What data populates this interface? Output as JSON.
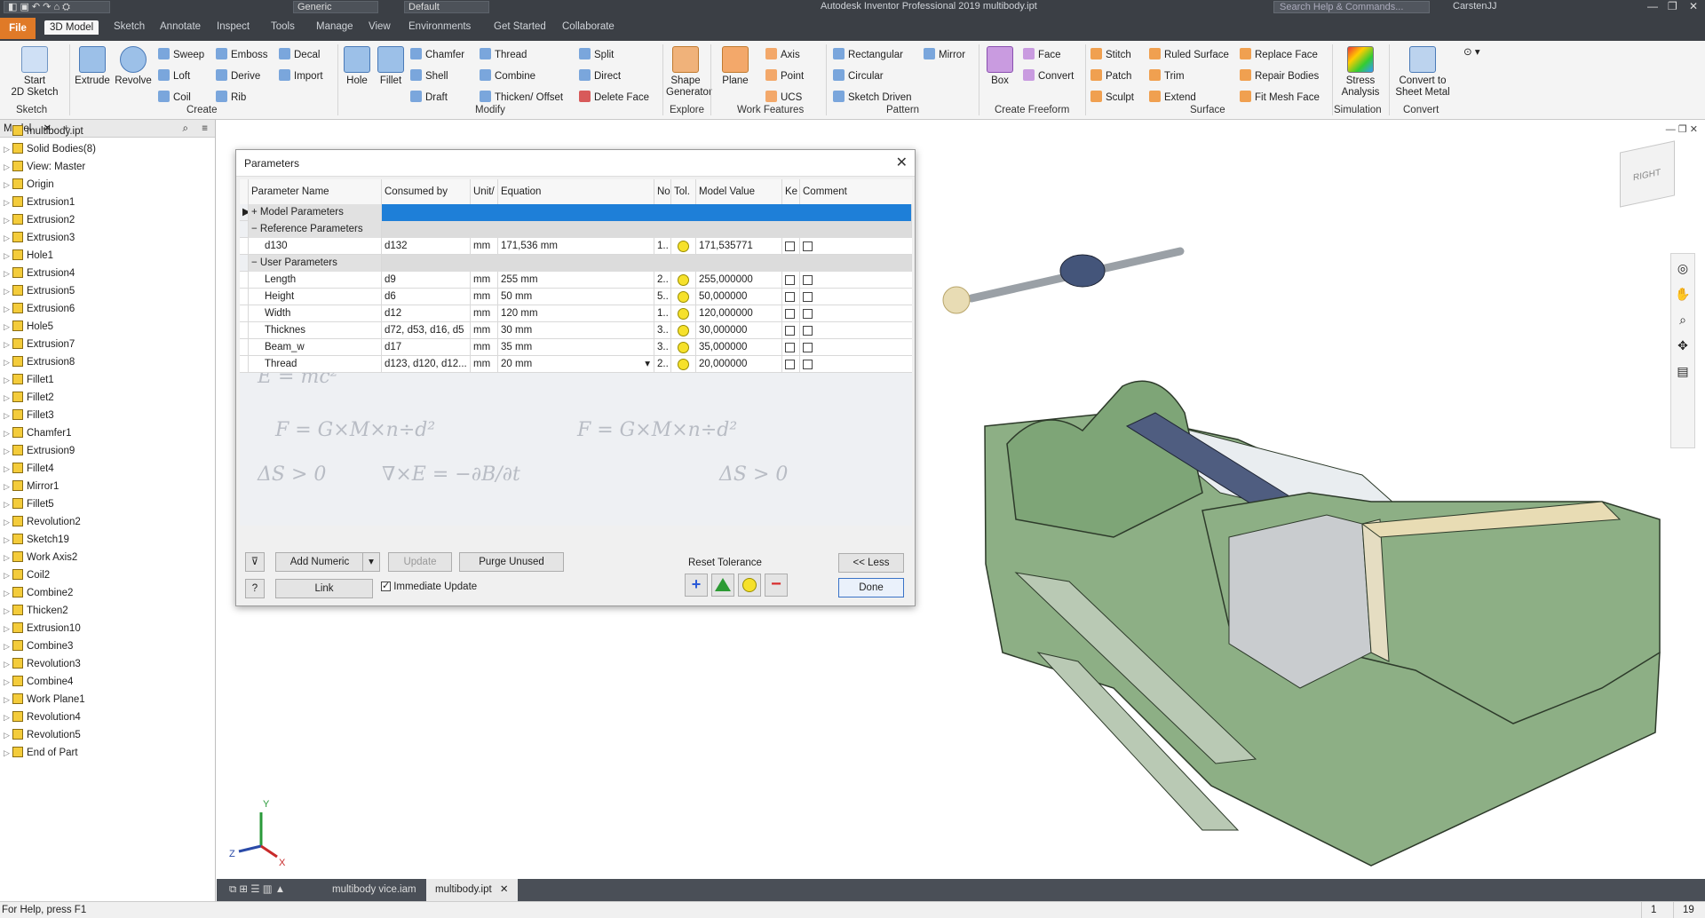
{
  "title_bar": {
    "app_title": "Autodesk Inventor Professional 2019   multibody.ipt",
    "search_placeholder": "Search Help & Commands...",
    "user": "CarstenJJ",
    "qa_material": "Generic",
    "qa_appearance": "Default"
  },
  "ribbon_tabs": {
    "file": "File",
    "tabs": [
      "3D Model",
      "Sketch",
      "Annotate",
      "Inspect",
      "Tools",
      "Manage",
      "View",
      "Environments",
      "Get Started",
      "Collaborate"
    ]
  },
  "ribbon": {
    "sketch": {
      "start_2d_sketch": "Start\n2D Sketch",
      "group": "Sketch"
    },
    "create": {
      "extrude": "Extrude",
      "revolve": "Revolve",
      "sweep": "Sweep",
      "emboss": "Emboss",
      "decal": "Decal",
      "loft": "Loft",
      "derive": "Derive",
      "import": "Import",
      "coil": "Coil",
      "rib": "Rib",
      "group": "Create"
    },
    "modify": {
      "hole": "Hole",
      "fillet": "Fillet",
      "chamfer": "Chamfer",
      "thread": "Thread",
      "split": "Split",
      "shell": "Shell",
      "combine": "Combine",
      "direct": "Direct",
      "draft": "Draft",
      "thicken_offset": "Thicken/ Offset",
      "delete_face": "Delete Face",
      "group": "Modify"
    },
    "explore": {
      "shape_generator": "Shape\nGenerator",
      "group": "Explore"
    },
    "work_features": {
      "plane": "Plane",
      "axis": "Axis",
      "point": "Point",
      "ucs": "UCS",
      "group": "Work Features"
    },
    "pattern": {
      "rectangular": "Rectangular",
      "circular": "Circular",
      "sketch_driven": "Sketch Driven",
      "mirror": "Mirror",
      "group": "Pattern"
    },
    "create_freeform": {
      "box": "Box",
      "face": "Face",
      "convert": "Convert",
      "group": "Create Freeform"
    },
    "surface": {
      "stitch": "Stitch",
      "patch": "Patch",
      "sculpt": "Sculpt",
      "ruled_surface": "Ruled Surface",
      "trim": "Trim",
      "extend": "Extend",
      "replace_face": "Replace Face",
      "repair_bodies": "Repair Bodies",
      "fit_mesh_face": "Fit Mesh Face",
      "group": "Surface"
    },
    "simulation": {
      "stress_analysis": "Stress\nAnalysis",
      "group": "Simulation"
    },
    "convert": {
      "convert_to_sheet_metal": "Convert to\nSheet Metal",
      "group": "Convert"
    }
  },
  "browser": {
    "tab": "Model",
    "items": [
      "multibody.ipt",
      "Solid Bodies(8)",
      "View: Master",
      "Origin",
      "Extrusion1",
      "Extrusion2",
      "Extrusion3",
      "Hole1",
      "Extrusion4",
      "Extrusion5",
      "Extrusion6",
      "Hole5",
      "Extrusion7",
      "Extrusion8",
      "Fillet1",
      "Fillet2",
      "Fillet3",
      "Chamfer1",
      "Extrusion9",
      "Fillet4",
      "Mirror1",
      "Fillet5",
      "Revolution2",
      "Sketch19",
      "Work Axis2",
      "Coil2",
      "Combine2",
      "Thicken2",
      "Extrusion10",
      "Combine3",
      "Revolution3",
      "Combine4",
      "Work Plane1",
      "Revolution4",
      "Revolution5",
      "End of Part"
    ]
  },
  "dialog": {
    "title": "Parameters",
    "columns": [
      "Parameter Name",
      "Consumed by",
      "Unit/",
      "Equation",
      "No",
      "Tol.",
      "Model Value",
      "Ke",
      "Comment"
    ],
    "groups": {
      "model": "Model Parameters",
      "reference": "Reference Parameters",
      "user": "User Parameters"
    },
    "reference_rows": [
      {
        "name": "d130",
        "consumed": "d132",
        "unit": "mm",
        "equation": "171,536 mm",
        "no": "1..",
        "value": "171,535771"
      }
    ],
    "user_rows": [
      {
        "name": "Length",
        "consumed": "d9",
        "unit": "mm",
        "equation": "255 mm",
        "no": "2..",
        "value": "255,000000"
      },
      {
        "name": "Height",
        "consumed": "d6",
        "unit": "mm",
        "equation": "50 mm",
        "no": "5..",
        "value": "50,000000"
      },
      {
        "name": "Width",
        "consumed": "d12",
        "unit": "mm",
        "equation": "120 mm",
        "no": "1..",
        "value": "120,000000"
      },
      {
        "name": "Thicknes",
        "consumed": "d72, d53, d16, d5",
        "unit": "mm",
        "equation": "30 mm",
        "no": "3..",
        "value": "30,000000"
      },
      {
        "name": "Beam_w",
        "consumed": "d17",
        "unit": "mm",
        "equation": "35 mm",
        "no": "3..",
        "value": "35,000000"
      },
      {
        "name": "Thread",
        "consumed": "d123, d120, d12...",
        "unit": "mm",
        "equation": "20 mm",
        "no": "2..",
        "value": "20,000000"
      }
    ],
    "buttons": {
      "add_numeric": "Add Numeric",
      "update": "Update",
      "purge_unused": "Purge Unused",
      "link": "Link",
      "immediate_update": "Immediate Update",
      "reset_tolerance": "Reset Tolerance",
      "less": "<< Less",
      "done": "Done"
    }
  },
  "doc_tabs": [
    "multibody vice.iam",
    "multibody.ipt"
  ],
  "status": {
    "help": "For Help, press F1",
    "num1": "1",
    "num2": "19"
  },
  "viewcube": {
    "face": "RIGHT"
  },
  "axis_labels": {
    "x": "X",
    "y": "Y",
    "z": "Z"
  },
  "colors": {
    "accent": "#1e7fd8",
    "selection": "#1e7fd8",
    "model_green": "#8daf85",
    "file_tab": "#e07a27"
  }
}
